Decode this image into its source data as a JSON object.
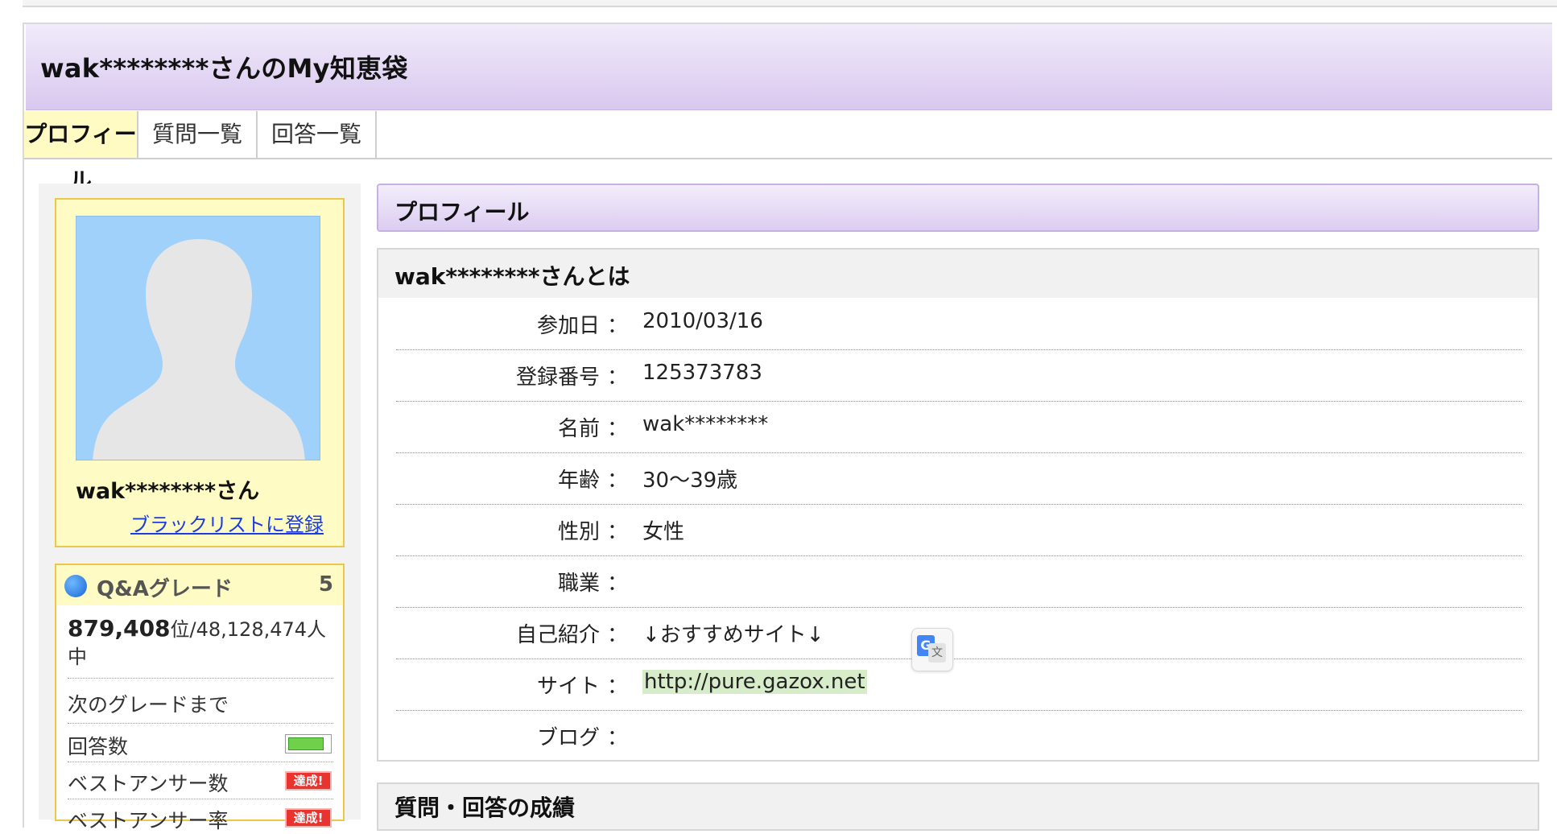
{
  "header": {
    "title": "wak********さんのMy知恵袋"
  },
  "tabs": [
    {
      "label": "プロフィール"
    },
    {
      "label": "質問一覧"
    },
    {
      "label": "回答一覧"
    }
  ],
  "profile_card": {
    "name": "wak********さん",
    "blacklist_link": "ブラックリストに登録"
  },
  "grade": {
    "label": "Q&Aグレード",
    "value": "5",
    "rank": "879,408",
    "rank_unit": "位",
    "rank_total": "/48,128,474人中",
    "next_grade": "次のグレードまで",
    "answers_label": "回答数",
    "answers_progress": 0.85,
    "best_answers_label": "ベストアンサー数",
    "best_answers_badge": "達成!",
    "best_rate_label": "ベストアンサー率",
    "best_rate_badge": "達成!"
  },
  "profile_section": {
    "title": "プロフィール"
  },
  "about": {
    "title": "wak********さんとは",
    "separator": "：",
    "rows": [
      {
        "key": "参加日",
        "value": "2010/03/16"
      },
      {
        "key": "登録番号",
        "value": "125373783"
      },
      {
        "key": "名前",
        "value": "wak********"
      },
      {
        "key": "年齢",
        "value": "30〜39歳"
      },
      {
        "key": "性別",
        "value": "女性"
      },
      {
        "key": "職業",
        "value": ""
      },
      {
        "key": "自己紹介",
        "value": "↓おすすめサイト↓"
      },
      {
        "key": "サイト",
        "value": "http://pure.gazox.net"
      },
      {
        "key": "ブログ",
        "value": ""
      }
    ]
  },
  "translate_button": {
    "g_glyph": "G",
    "text_glyph": "文"
  },
  "results_section": {
    "title": "質問・回答の成績"
  }
}
